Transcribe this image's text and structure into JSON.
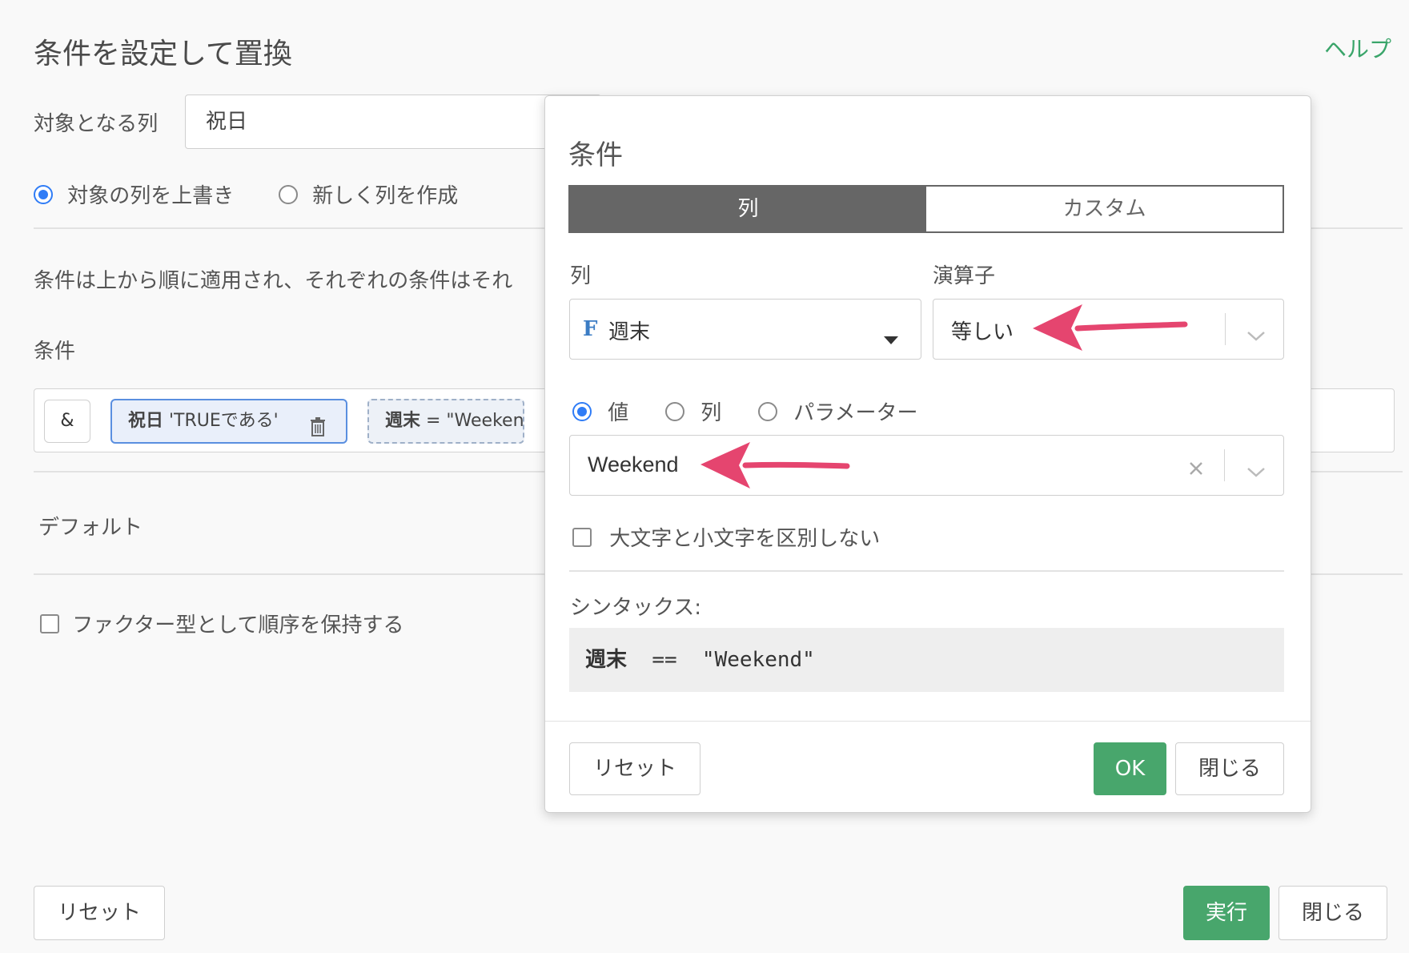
{
  "page": {
    "title": "条件を設定して置換",
    "help_label": "ヘルプ"
  },
  "target": {
    "label": "対象となる列",
    "value": "祝日"
  },
  "mode": {
    "overwrite_label": "対象の列を上書き",
    "new_column_label": "新しく列を作成",
    "selected": "overwrite"
  },
  "description": "条件は上から順に適用され、それぞれの条件はそれ",
  "conditions": {
    "label": "条件",
    "and_label": "&",
    "chips": [
      {
        "column": "祝日",
        "expr": " 'TRUEである'"
      },
      {
        "column": "週末",
        "expr": " = \"Weeken"
      }
    ]
  },
  "default_label": "デフォルト",
  "factor_label": "ファクター型として順序を保持する",
  "footer": {
    "reset_label": "リセット",
    "run_label": "実行",
    "close_label": "閉じる"
  },
  "dialog": {
    "title": "条件",
    "tabs": [
      {
        "label": "列",
        "active": true
      },
      {
        "label": "カスタム",
        "active": false
      }
    ],
    "column_label": "列",
    "operator_label": "演算子",
    "column_type_badge": "F",
    "column_value": "週末",
    "operator_value": "等しい",
    "value_types": [
      {
        "label": "値",
        "selected": true
      },
      {
        "label": "列",
        "selected": false
      },
      {
        "label": "パラメーター",
        "selected": false
      }
    ],
    "value": "Weekend",
    "case_insensitive_label": "大文字と小文字を区別しない",
    "syntax_label": "シンタックス:",
    "syntax": {
      "column": "週末",
      "rest": "  ==  \"Weekend\""
    },
    "reset_label": "リセット",
    "ok_label": "OK",
    "close_label": "閉じる"
  },
  "colors": {
    "accent": "#48a66c",
    "radio": "#2f7cf6",
    "arrow": "#e5456f",
    "tab_active": "#666666"
  },
  "icons": {
    "trash": "trash-icon",
    "caret": "caret-down-icon",
    "chevron": "chevron-down-icon",
    "clear": "clear-x-icon",
    "arrow": "annotation-arrow-icon"
  }
}
